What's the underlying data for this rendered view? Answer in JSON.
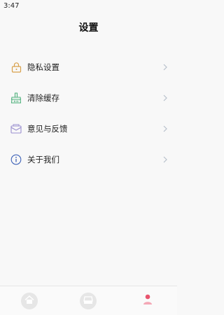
{
  "status_bar": {
    "time": "3:47"
  },
  "header": {
    "title": "设置"
  },
  "menu": {
    "items": [
      {
        "label": "隐私设置",
        "icon": "lock-icon"
      },
      {
        "label": "清除缓存",
        "icon": "broom-icon"
      },
      {
        "label": "意见与反馈",
        "icon": "feedback-mail-icon"
      },
      {
        "label": "关于我们",
        "icon": "info-icon"
      }
    ]
  },
  "tabbar": {
    "tabs": [
      {
        "icon": "home-icon",
        "active": false
      },
      {
        "icon": "inbox-tray-icon",
        "active": false
      },
      {
        "icon": "user-icon",
        "active": true
      }
    ],
    "colors": {
      "inactive_bg": "#e6e6e6",
      "inactive_icon": "#ffffff",
      "active": "#e8546e"
    }
  }
}
